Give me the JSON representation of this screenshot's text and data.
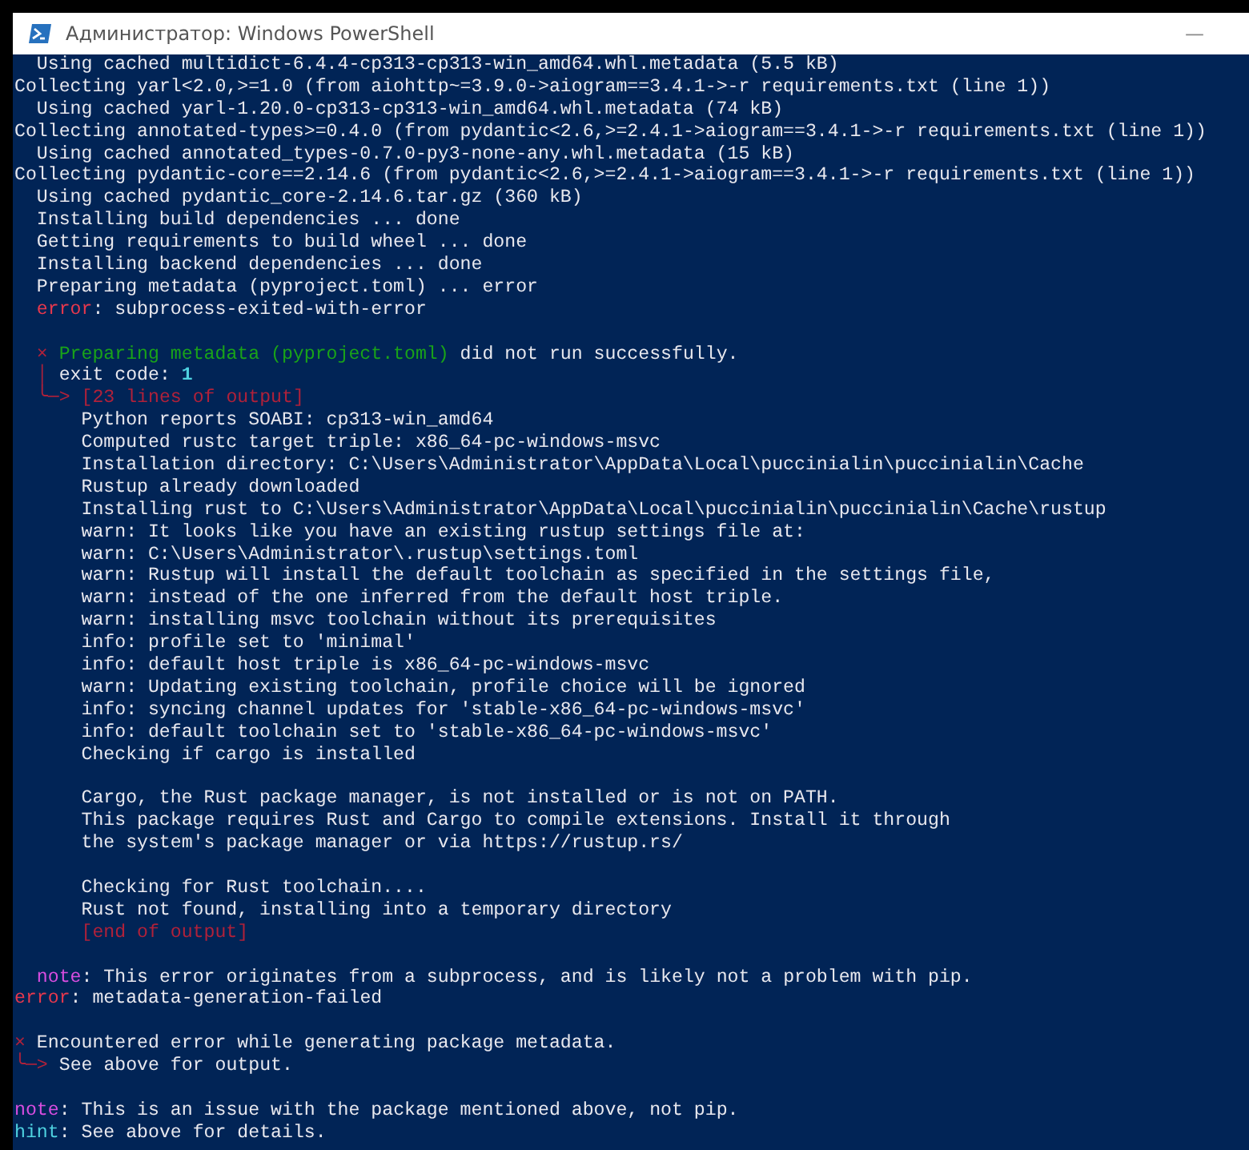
{
  "window": {
    "title": "Администратор: Windows PowerShell",
    "minimize": "—"
  },
  "console": {
    "lines": [
      {
        "kind": "step",
        "text": "Using cached multidict-6.4.4-cp313-cp313-win_amd64.whl.metadata (5.5 kB)"
      },
      {
        "kind": "top",
        "text": "Collecting yarl<2.0,>=1.0 (from aiohttp~=3.9.0->aiogram==3.4.1->-r requirements.txt (line 1))"
      },
      {
        "kind": "step",
        "text": "Using cached yarl-1.20.0-cp313-cp313-win_amd64.whl.metadata (74 kB)"
      },
      {
        "kind": "top",
        "text": "Collecting annotated-types>=0.4.0 (from pydantic<2.6,>=2.4.1->aiogram==3.4.1->-r requirements.txt (line 1))"
      },
      {
        "kind": "step",
        "text": "Using cached annotated_types-0.7.0-py3-none-any.whl.metadata (15 kB)"
      },
      {
        "kind": "top",
        "text": "Collecting pydantic-core==2.14.6 (from pydantic<2.6,>=2.4.1->aiogram==3.4.1->-r requirements.txt (line 1))"
      },
      {
        "kind": "step",
        "text": "Using cached pydantic_core-2.14.6.tar.gz (360 kB)"
      },
      {
        "kind": "step",
        "text": "Installing build dependencies ... done"
      },
      {
        "kind": "step",
        "text": "Getting requirements to build wheel ... done"
      },
      {
        "kind": "step",
        "text": "Installing backend dependencies ... done"
      },
      {
        "kind": "step",
        "text": "Preparing metadata (pyproject.toml) ... error"
      },
      {
        "kind": "step",
        "parts": [
          {
            "kind": "error",
            "text": "error"
          },
          {
            "kind": "plain",
            "text": ": subprocess-exited-with-error"
          }
        ]
      },
      {
        "kind": "blank"
      },
      {
        "kind": "step",
        "parts": [
          {
            "kind": "dim",
            "text": "×"
          },
          {
            "kind": "green",
            "text": "Preparing metadata (pyproject.toml)"
          },
          {
            "kind": "plain",
            "text": "did not run successfully."
          }
        ]
      },
      {
        "kind": "step",
        "parts": [
          {
            "kind": "dim",
            "text": "│"
          },
          {
            "kind": "plain",
            "text": "exit code:"
          },
          {
            "kind": "number",
            "text": "1"
          }
        ]
      },
      {
        "kind": "step",
        "parts": [
          {
            "kind": "dim",
            "text": "╰─>"
          },
          {
            "kind": "dim",
            "text": "[23 lines of output]"
          }
        ]
      },
      {
        "kind": "output",
        "text": "Python reports SOABI: cp313-win_amd64"
      },
      {
        "kind": "output",
        "text": "Computed rustc target triple: x86_64-pc-windows-msvc"
      },
      {
        "kind": "output",
        "text": "Installation directory: C:\\Users\\Administrator\\AppData\\Local\\puccinialin\\puccinialin\\Cache"
      },
      {
        "kind": "output",
        "text": "Rustup already downloaded"
      },
      {
        "kind": "output",
        "text": "Installing rust to C:\\Users\\Administrator\\AppData\\Local\\puccinialin\\puccinialin\\Cache\\rustup"
      },
      {
        "kind": "output",
        "text": "warn: It looks like you have an existing rustup settings file at:"
      },
      {
        "kind": "output",
        "text": "warn: C:\\Users\\Administrator\\.rustup\\settings.toml"
      },
      {
        "kind": "output",
        "text": "warn: Rustup will install the default toolchain as specified in the settings file,"
      },
      {
        "kind": "output",
        "text": "warn: instead of the one inferred from the default host triple."
      },
      {
        "kind": "output",
        "text": "warn: installing msvc toolchain without its prerequisites"
      },
      {
        "kind": "output",
        "text": "info: profile set to 'minimal'"
      },
      {
        "kind": "output",
        "text": "info: default host triple is x86_64-pc-windows-msvc"
      },
      {
        "kind": "output",
        "text": "warn: Updating existing toolchain, profile choice will be ignored"
      },
      {
        "kind": "output",
        "text": "info: syncing channel updates for 'stable-x86_64-pc-windows-msvc'"
      },
      {
        "kind": "output",
        "text": "info: default toolchain set to 'stable-x86_64-pc-windows-msvc'"
      },
      {
        "kind": "output",
        "text": "Checking if cargo is installed"
      },
      {
        "kind": "blank"
      },
      {
        "kind": "output",
        "text": "Cargo, the Rust package manager, is not installed or is not on PATH."
      },
      {
        "kind": "output",
        "text": "This package requires Rust and Cargo to compile extensions. Install it through"
      },
      {
        "kind": "output",
        "text": "the system's package manager or via https://rustup.rs/"
      },
      {
        "kind": "blank"
      },
      {
        "kind": "output",
        "text": "Checking for Rust toolchain...."
      },
      {
        "kind": "output",
        "text": "Rust not found, installing into a temporary directory"
      },
      {
        "kind": "output",
        "parts": [
          {
            "kind": "dim",
            "text": "[end of output]"
          }
        ]
      },
      {
        "kind": "blank"
      },
      {
        "kind": "step",
        "parts": [
          {
            "kind": "note",
            "text": "note"
          },
          {
            "kind": "plain",
            "text": ": This error originates from a subprocess, and is likely not a problem with pip."
          }
        ]
      },
      {
        "kind": "top",
        "parts": [
          {
            "kind": "error",
            "text": "error"
          },
          {
            "kind": "plain",
            "text": ": metadata-generation-failed"
          }
        ]
      },
      {
        "kind": "blank"
      },
      {
        "kind": "top",
        "parts": [
          {
            "kind": "dim",
            "text": "×"
          },
          {
            "kind": "plain",
            "text": "Encountered error while generating package metadata."
          }
        ]
      },
      {
        "kind": "top",
        "parts": [
          {
            "kind": "dim",
            "text": "╰─>"
          },
          {
            "kind": "plain",
            "text": "See above for output."
          }
        ]
      },
      {
        "kind": "blank"
      },
      {
        "kind": "top",
        "parts": [
          {
            "kind": "note",
            "text": "note"
          },
          {
            "kind": "plain",
            "text": ": This is an issue with the package mentioned above, not pip."
          }
        ]
      },
      {
        "kind": "top",
        "parts": [
          {
            "kind": "hint",
            "text": "hint"
          },
          {
            "kind": "plain",
            "text": ": See above for details."
          }
        ]
      }
    ]
  }
}
